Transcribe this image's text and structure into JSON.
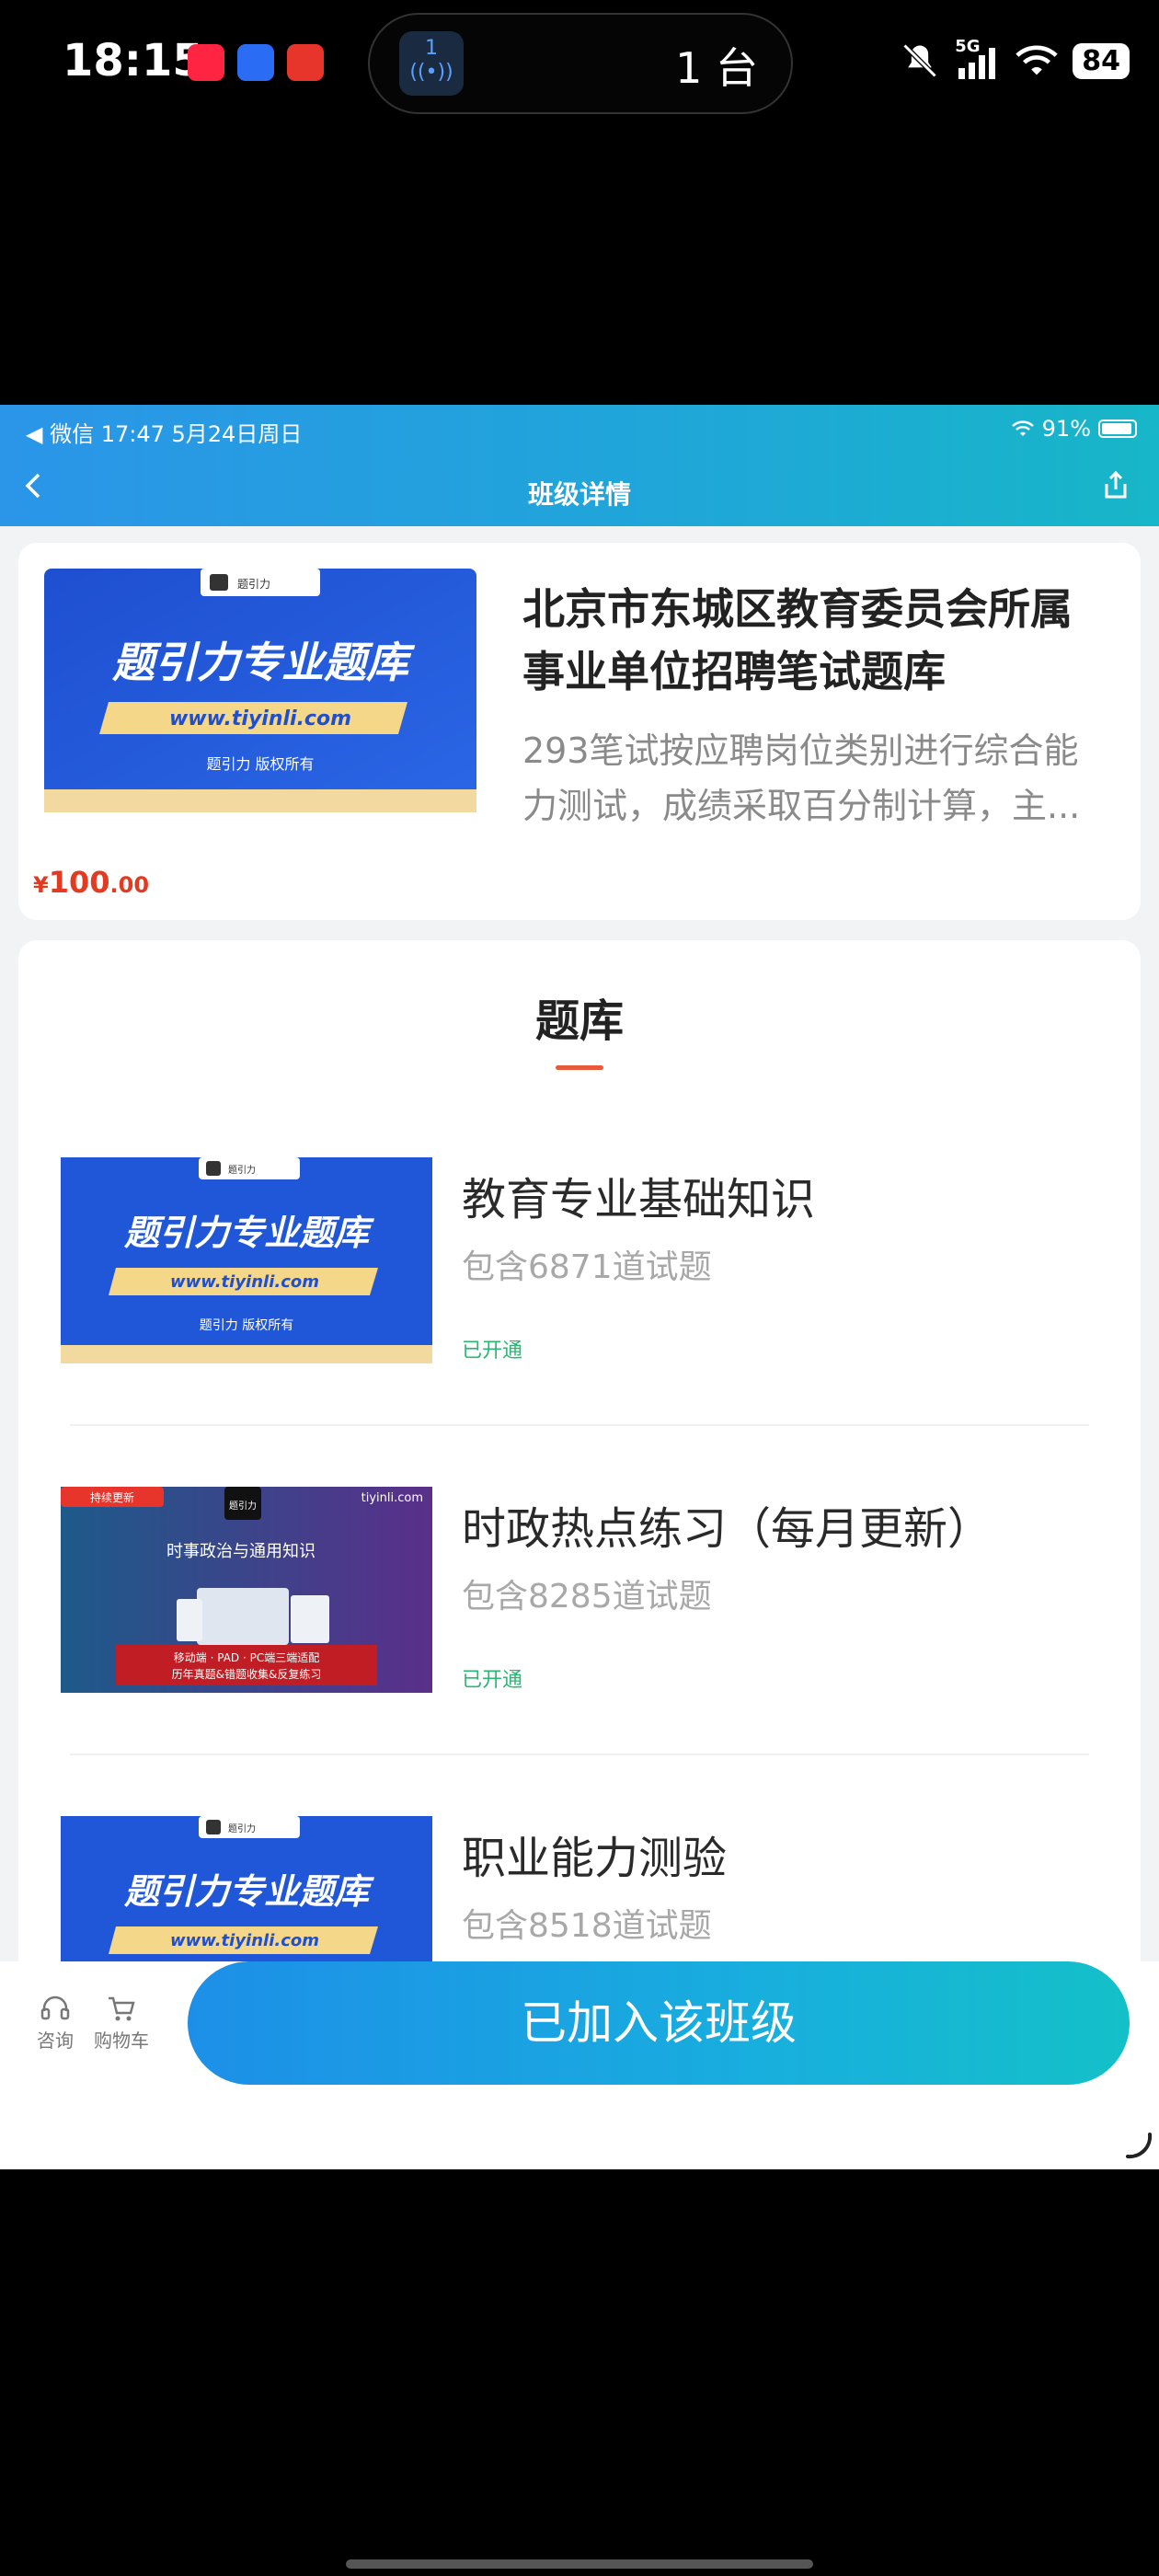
{
  "status_bar": {
    "time": "18:15",
    "pill_badge": "1",
    "pill_text": "1 台",
    "network": "5G",
    "battery": "84"
  },
  "app": {
    "ios_status": {
      "left": "◀ 微信   17:47   5月24日周日",
      "battery_pct": "91%"
    },
    "header": {
      "title": "班级详情"
    },
    "course": {
      "title": "北京市东城区教育委员会所属事业单位招聘笔试题库",
      "description": "293笔试按应聘岗位类别进行综合能力测试，成绩采取百分制计算，主...",
      "price": {
        "currency": "¥",
        "integer": "100",
        "decimal": ".00"
      },
      "image": {
        "brand_small": "题引力",
        "banner_title": "题引力专业题库",
        "url": "www.tiyinli.com",
        "copyright": "题引力 版权所有"
      }
    },
    "bank": {
      "section_title": "题库",
      "items": [
        {
          "name": "教育专业基础知识",
          "count": "包含6871道试题",
          "status": "已开通",
          "thumb": {
            "brand_small": "题引力",
            "banner_title": "题引力专业题库",
            "url": "www.tiyinli.com",
            "copyright": "题引力 版权所有"
          }
        },
        {
          "name": "时政热点练习（每月更新）",
          "count": "包含8285道试题",
          "status": "已开通",
          "thumb": {
            "tag": "持续更新",
            "brand": "题引力",
            "site": "tiyinli.com",
            "heading": "时事政治与通用知识",
            "line1": "移动端 · PAD · PC端三端适配",
            "line2": "历年真题&错题收集&反复练习"
          }
        },
        {
          "name": "职业能力测验",
          "count": "包含8518道试题",
          "status": "",
          "thumb": {
            "brand_small": "题引力",
            "banner_title": "题引力专业题库",
            "url": "www.tiyinli.com",
            "copyright": ""
          }
        }
      ]
    },
    "bottom_bar": {
      "consult_label": "咨询",
      "cart_label": "购物车",
      "join_label": "已加入该班级"
    }
  }
}
